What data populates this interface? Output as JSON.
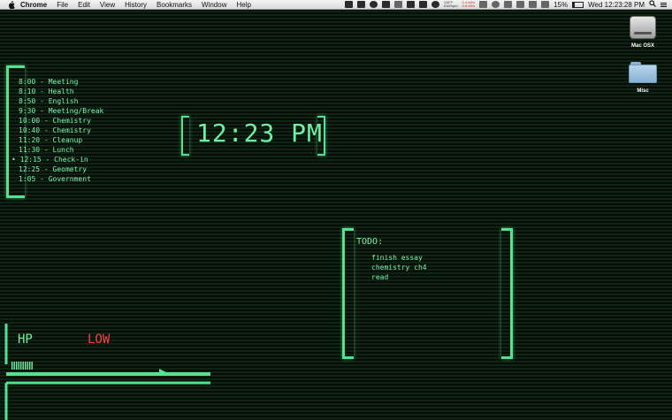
{
  "menubar": {
    "app_name": "Chrome",
    "menus": [
      "File",
      "Edit",
      "View",
      "History",
      "Bookmarks",
      "Window",
      "Help"
    ],
    "status_stack_1": [
      "126°F",
      "5160rpm"
    ],
    "status_stack_2": [
      "0.4 kB/s",
      "0.8 kB/s"
    ],
    "battery_percent": "15%",
    "battery_level": 0.15,
    "clock": "Wed 12:23:28 PM"
  },
  "desktop": {
    "icons": [
      {
        "label": "Mac OSX",
        "icon": "hard-drive-icon"
      },
      {
        "label": "Misc",
        "icon": "folder-icon"
      }
    ]
  },
  "schedule": {
    "items": [
      {
        "text": "8:00 - Meeting"
      },
      {
        "text": "8:10 - Health"
      },
      {
        "text": "8:50 - English"
      },
      {
        "text": "9:30 - Meeting/Break"
      },
      {
        "text": "10:00 - Chemistry"
      },
      {
        "text": "10:40 - Chemistry"
      },
      {
        "text": "11:20 - Cleanup"
      },
      {
        "text": "11:30 - Lunch"
      },
      {
        "text": "• 12:15 - Check-in"
      },
      {
        "text": "12:25 - Geometry"
      },
      {
        "text": "1:05 - Government"
      }
    ]
  },
  "clock_widget": {
    "time": "12:23 PM"
  },
  "todo": {
    "title": "TODO:",
    "items": [
      {
        "text": "finish essay"
      },
      {
        "text": "chemistry ch4"
      },
      {
        "text": "read"
      }
    ]
  },
  "hud": {
    "hp_label": "HP",
    "status_label": "LOW",
    "hp_level": 0.13,
    "colors": {
      "accent": "#6ff0a2",
      "warning": "#ff4040"
    }
  }
}
